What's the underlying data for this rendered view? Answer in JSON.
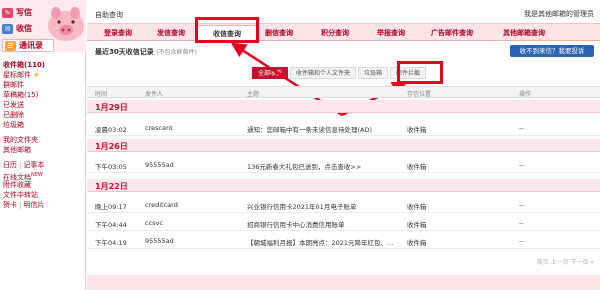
{
  "sidebar": {
    "write_label": "写信",
    "inbox_label": "收信",
    "contacts_label": "通讯录",
    "folders": [
      {
        "label": "收件箱(110)"
      },
      {
        "label": "星标邮件"
      },
      {
        "label": "群邮件"
      },
      {
        "label": "草稿箱(15)"
      },
      {
        "label": "已发送"
      },
      {
        "label": "已删除"
      },
      {
        "label": "垃圾箱"
      }
    ],
    "my_folders_label": "我的文件夹",
    "other_mail_label": "其他邮箱",
    "calendar_label": "日历",
    "notes_label": "记事本",
    "online_docs_label": "在线文档",
    "new_badge": "NEW",
    "attachments_label": "附件收藏",
    "file_transfer_label": "文件中转站",
    "cards_label": "贺卡",
    "postcards_label": "明信片"
  },
  "header": {
    "title": "自助查询",
    "complaint_link": "我是其他邮箱的管理员"
  },
  "tabs": [
    {
      "label": "登录查询"
    },
    {
      "label": "发信查询"
    },
    {
      "label": "收信查询"
    },
    {
      "label": "删信查询"
    },
    {
      "label": "积分查询"
    },
    {
      "label": "举报查询"
    },
    {
      "label": "广告邮件查询"
    },
    {
      "label": "其他邮箱查询"
    }
  ],
  "subhead": {
    "title": "最近30天收信记录",
    "note": "(不包含群邮件)"
  },
  "appeal_button": "收不到来信？我要投诉",
  "filters": [
    {
      "label": "全部收信"
    },
    {
      "label": "收件箱和个人文件夹"
    },
    {
      "label": "垃圾箱"
    },
    {
      "label": "邮件拦截"
    }
  ],
  "table": {
    "columns": [
      "时间",
      "发件人",
      "主题",
      "存信位置",
      "操作"
    ],
    "groups": [
      {
        "date": "1月29日",
        "rows": [
          {
            "time": "凌晨03:02",
            "sender": "crescent",
            "subject": "通知：您邮箱中有一条未读信息待处理(AD)",
            "location": "收件箱",
            "action": "--"
          }
        ]
      },
      {
        "date": "1月26日",
        "rows": [
          {
            "time": "下午03:05",
            "sender": "95555ad",
            "subject": "136元新春大礼包已送到，点击查收>>",
            "location": "收件箱",
            "action": "--"
          }
        ]
      },
      {
        "date": "1月22日",
        "rows": [
          {
            "time": "晚上09:17",
            "sender": "creditcard",
            "subject": "兴业银行信用卡2021年01月电子账单",
            "location": "收件箱",
            "action": "--"
          },
          {
            "time": "下午04:44",
            "sender": "ccsvc",
            "subject": "招商银行信用卡中心消费信用账单",
            "location": "收件箱",
            "action": "--"
          },
          {
            "time": "下午04:19",
            "sender": "95555ad",
            "subject": "【朝城福利月报】本期亮点：2021元降年红包、…",
            "location": "收件箱",
            "action": "--"
          }
        ]
      }
    ]
  },
  "pager": "首页 上一页 下一页 »",
  "colors": {
    "accent": "#c8102e",
    "highlight": "#e6001f",
    "tab_bg": "#fbe3e8",
    "button_blue": "#2c63b5"
  }
}
